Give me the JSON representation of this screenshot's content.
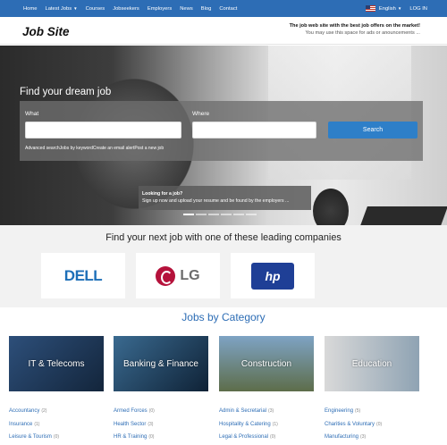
{
  "nav": {
    "items": [
      "Home",
      "Latest Jobs",
      "Courses",
      "Jobseekers",
      "Employers",
      "News",
      "Blog",
      "Contact"
    ],
    "language": "English",
    "login": "LOG IN"
  },
  "header": {
    "logo": "Job Site",
    "tagline1": "The job web site with the best job offers on the market!",
    "tagline2": "You may use this space for ads or anouncements ..."
  },
  "hero": {
    "title": "Find your dream job",
    "what_label": "What",
    "where_label": "Where",
    "search_button": "Search",
    "links": [
      "Advanced search",
      "Jobs by keyword",
      "Create an email alert",
      "Post a new job"
    ],
    "banner_title": "Looking for a job?",
    "banner_text": "Sign up now and upload your resume and be found by the employers ..."
  },
  "companies": {
    "title": "Find your next job with one of these leading companies",
    "logos": [
      "DELL",
      "LG",
      "hp"
    ]
  },
  "categories": {
    "title": "Jobs by Category",
    "cards": [
      {
        "label": "IT & Telecoms",
        "bg": "#2d4f7a"
      },
      {
        "label": "Banking & Finance",
        "bg": "#1f3d5c"
      },
      {
        "label": "Construction",
        "bg": "#6b8fb0"
      },
      {
        "label": "Education",
        "bg": "#8a9aa6"
      }
    ],
    "columns": [
      [
        {
          "name": "Accountancy",
          "count": "(2)"
        },
        {
          "name": "Insurance",
          "count": "(1)"
        },
        {
          "name": "Leisure & Tourism",
          "count": "(0)"
        }
      ],
      [
        {
          "name": "Armed Forces",
          "count": "(0)"
        },
        {
          "name": "Health Sector",
          "count": "(3)"
        },
        {
          "name": "HR & Training",
          "count": "(0)"
        }
      ],
      [
        {
          "name": "Admin & Secretarial",
          "count": "(3)"
        },
        {
          "name": "Hospitality & Catering",
          "count": "(1)"
        },
        {
          "name": "Legal & Professional",
          "count": "(0)"
        }
      ],
      [
        {
          "name": "Engineering",
          "count": "(5)"
        },
        {
          "name": "Charities & Voluntary",
          "count": "(0)"
        },
        {
          "name": "Manufacturing",
          "count": "(3)"
        }
      ]
    ]
  }
}
